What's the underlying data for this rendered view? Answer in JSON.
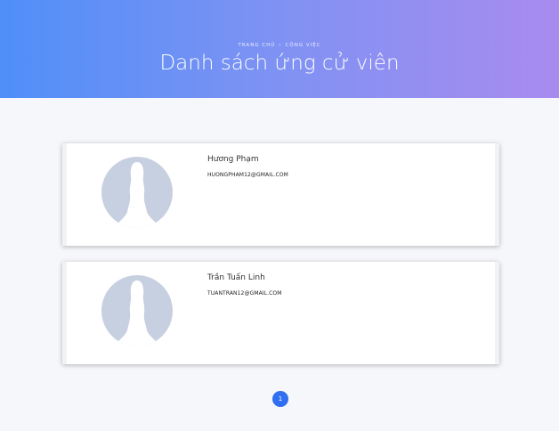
{
  "header": {
    "breadcrumb": [
      "TRANG CHỦ",
      "CÔNG VIỆC"
    ],
    "separator": "›",
    "title": "Danh sách ứng cử viên",
    "gradient_start": "#4f8ff8",
    "gradient_end": "#a98bef"
  },
  "candidates": [
    {
      "name": "Hương Phạm",
      "email": "HUONGPHAM12@GMAIL.COM",
      "avatar_icon": "default-avatar-silhouette"
    },
    {
      "name": "Trần Tuấn Linh",
      "email": "TUANTRAN12@GMAIL.COM",
      "avatar_icon": "default-avatar-silhouette"
    }
  ],
  "pagination": {
    "current_page": "1",
    "accent_color": "#2f6ff0"
  }
}
